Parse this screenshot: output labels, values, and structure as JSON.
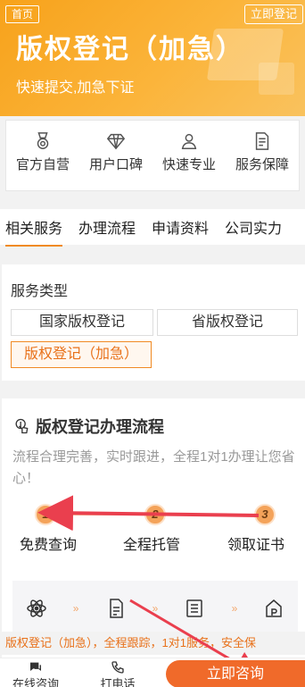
{
  "header": {
    "home_label": "首页",
    "register_label": "立即登记",
    "title": "版权登记（加急）",
    "subtitle": "快速提交,加急下证"
  },
  "features": [
    {
      "label": "官方自营",
      "icon": "medal-icon"
    },
    {
      "label": "用户口碑",
      "icon": "diamond-icon"
    },
    {
      "label": "快速专业",
      "icon": "person-icon"
    },
    {
      "label": "服务保障",
      "icon": "document-icon"
    }
  ],
  "tabs": [
    "相关服务",
    "办理流程",
    "申请资料",
    "公司实力"
  ],
  "service": {
    "heading": "服务类型",
    "options": [
      "国家版权登记",
      "省版权登记",
      "版权登记（加急）"
    ],
    "selected": "版权登记（加急）"
  },
  "process": {
    "title": "版权登记办理流程",
    "description": "流程合理完善，实时跟进，全程1对1办理让您省心！",
    "steps": [
      {
        "num": "1",
        "label": "免费查询"
      },
      {
        "num": "2",
        "label": "全程托管"
      },
      {
        "num": "3",
        "label": "领取证书"
      }
    ],
    "ticker": "版权登记（加急），全程跟踪，1对1服务，安全保"
  },
  "bottom_bar": {
    "online_label": "在线咨询",
    "phone_label": "打电话",
    "consult_label": "立即咨询"
  },
  "colors": {
    "accent": "#f08a24",
    "hero": "#f7a21b",
    "cta": "#f06a2a"
  }
}
